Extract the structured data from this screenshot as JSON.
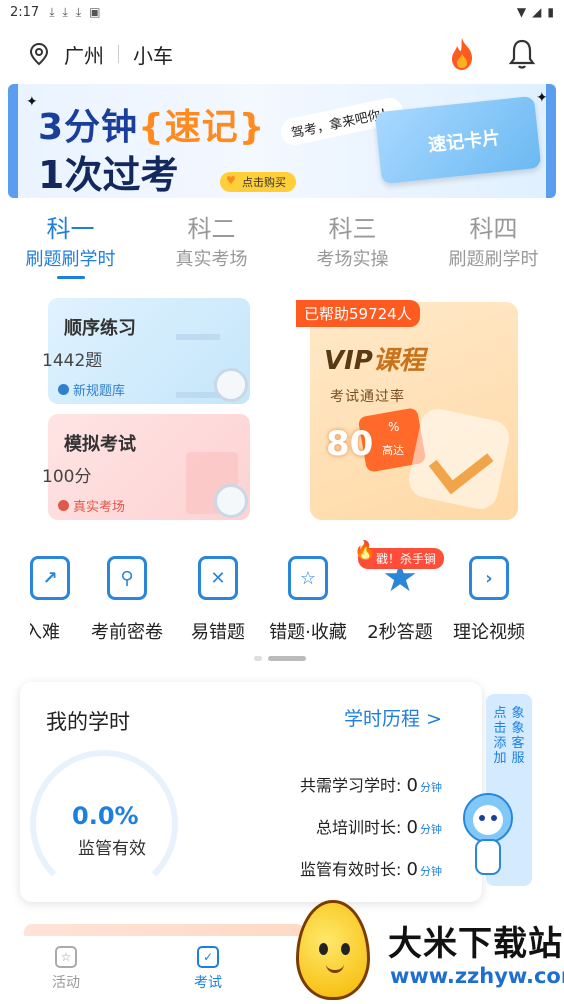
{
  "status_bar": {
    "time": "2:17",
    "notif_icons": [
      "download-icon",
      "download-icon",
      "download-icon",
      "a-icon"
    ],
    "system_icons": [
      "wifi-icon",
      "signal-icon",
      "battery-icon"
    ]
  },
  "header": {
    "city": "广州",
    "vehicle": "小车"
  },
  "banner": {
    "line1_a": "3分钟",
    "line1_b": "{速记}",
    "line2": "1次过考",
    "bubble": "驾考，拿来吧你！",
    "card_text": "速记卡片",
    "cta": "点击购买"
  },
  "tabs": [
    {
      "title": "科一",
      "sub": "刷题刷学时"
    },
    {
      "title": "科二",
      "sub": "真实考场"
    },
    {
      "title": "科三",
      "sub": "考场实操"
    },
    {
      "title": "科四",
      "sub": "刷题刷学时"
    }
  ],
  "practice": {
    "sequential": {
      "title": "顺序练习",
      "count": "1442题",
      "sub": "新规题库"
    },
    "mock": {
      "title": "模拟考试",
      "count": "100分",
      "sub": "真实考场"
    }
  },
  "vip": {
    "badge": "已帮助59724人",
    "title_a": "VIP",
    "title_b": "课程",
    "rate_label": "考试通过率",
    "rate": "80",
    "pct": "%",
    "high": "高达"
  },
  "actions": [
    {
      "label": "由浅入难",
      "icon": "trend-icon",
      "glyph": "↗"
    },
    {
      "label": "考前密卷",
      "icon": "secret-paper-icon",
      "glyph": "⚲"
    },
    {
      "label": "易错题",
      "icon": "wrong-book-icon",
      "glyph": "✕"
    },
    {
      "label": "错题·收藏",
      "icon": "favorite-icon",
      "glyph": "☆"
    },
    {
      "label": "2秒答题",
      "icon": "star-icon",
      "glyph": "★"
    },
    {
      "label": "理论视频",
      "icon": "video-icon",
      "glyph": "›"
    }
  ],
  "hot_tag": "戳！杀手锏",
  "study": {
    "title": "我的学时",
    "link": "学时历程 >",
    "percent": "0.0%",
    "percent_label": "监管有效",
    "stats": [
      {
        "label": "共需学习学时:",
        "value": "0",
        "unit": "分钟"
      },
      {
        "label": "总培训时长:",
        "value": "0",
        "unit": "分钟"
      },
      {
        "label": "监管有效时长:",
        "value": "0",
        "unit": "分钟"
      }
    ]
  },
  "service": {
    "col1": "点击添加",
    "col2": "象象客服"
  },
  "bottom_nav": [
    {
      "label": "活动",
      "icon": "activity-icon"
    },
    {
      "label": "考试",
      "icon": "exam-icon"
    }
  ],
  "watermark": {
    "title": "大米下载站",
    "url": "www.zzhyw.com"
  }
}
